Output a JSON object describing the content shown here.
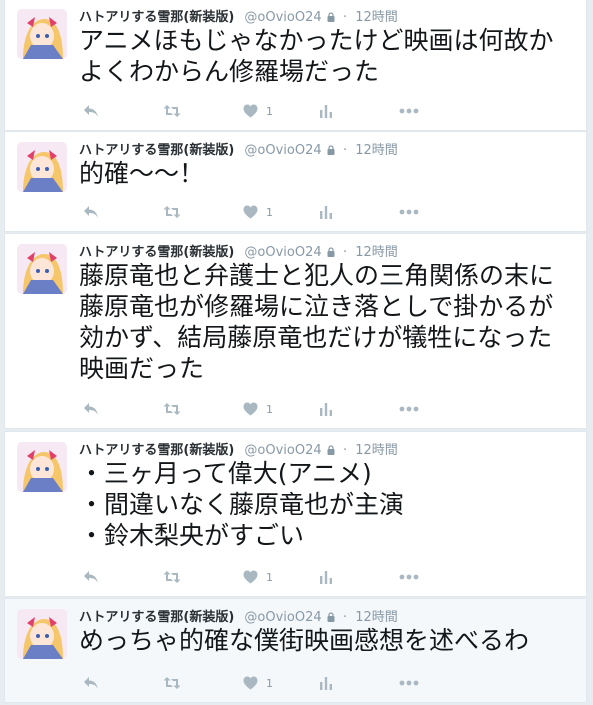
{
  "account": {
    "name": "ハトアリする雪那(新装版)",
    "handle": "@oOvioO24",
    "separator": "·",
    "icon": "lock-icon"
  },
  "colors": {
    "background": "#e6ecf0",
    "card": "#ffffff",
    "highlight_card": "#f5f8fa",
    "meta_text": "#8899a6",
    "body_text": "#14171a"
  },
  "tweets": [
    {
      "time": "12時間",
      "lines": [
        "アニメほもじゃなかったけど映画は何故か",
        "よくわからん修羅場だった"
      ],
      "likes": "1"
    },
    {
      "time": "12時間",
      "lines": [
        "的確〜〜！"
      ],
      "likes": "1"
    },
    {
      "time": "12時間",
      "lines": [
        "藤原竜也と弁護士と犯人の三角関係の末に",
        "藤原竜也が修羅場に泣き落としで掛かるが",
        "効かず、結局藤原竜也だけが犠牲になった",
        "映画だった"
      ],
      "likes": "1"
    },
    {
      "time": "12時間",
      "lines": [
        "・三ヶ月って偉大(アニメ)",
        "・間違いなく藤原竜也が主演",
        "・鈴木梨央がすごい"
      ],
      "likes": "1"
    },
    {
      "time": "12時間",
      "lines": [
        "めっちゃ的確な僕街映画感想を述べるわ"
      ],
      "likes": "1"
    }
  ],
  "action_icons": [
    "reply-icon",
    "retweet-icon",
    "like-icon",
    "analytics-icon",
    "more-icon"
  ]
}
